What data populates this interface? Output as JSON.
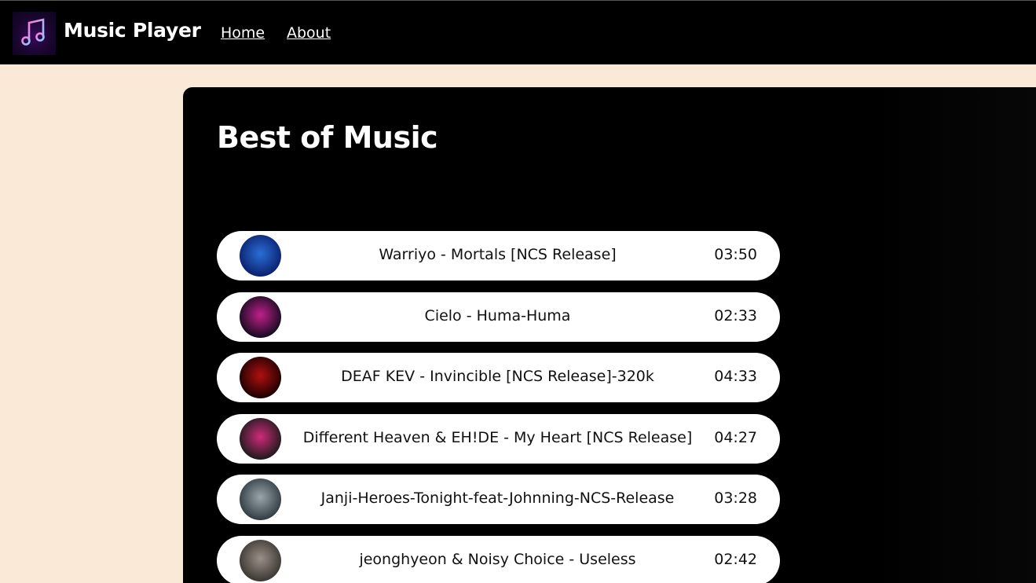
{
  "header": {
    "brand": "Music Player",
    "nav": [
      {
        "label": "Home"
      },
      {
        "label": "About"
      }
    ]
  },
  "main": {
    "title": "Best of Music",
    "songs": [
      {
        "name": "Warriyo - Mortals [NCS Release]",
        "duration": "03:50",
        "cover_colors": [
          "#0a1f6e",
          "#2a6fd6"
        ],
        "cover_text": ""
      },
      {
        "name": "Cielo - Huma-Huma",
        "duration": "02:33",
        "cover_colors": [
          "#120a1e",
          "#c0208a"
        ],
        "cover_text": ""
      },
      {
        "name": "DEAF KEV - Invincible [NCS Release]-320k",
        "duration": "04:33",
        "cover_colors": [
          "#1a0000",
          "#b01010"
        ],
        "cover_text": ""
      },
      {
        "name": "Different Heaven & EH!DE - My Heart [NCS Release]",
        "duration": "04:27",
        "cover_colors": [
          "#1a1a1a",
          "#d02a7a"
        ],
        "cover_text": ""
      },
      {
        "name": "Janji-Heroes-Tonight-feat-Johnning-NCS-Release",
        "duration": "03:28",
        "cover_colors": [
          "#2e3a40",
          "#9aa6ac"
        ],
        "cover_text": ""
      },
      {
        "name": "jeonghyeon & Noisy Choice - Useless",
        "duration": "02:42",
        "cover_colors": [
          "#3a3530",
          "#9a9088"
        ],
        "cover_text": ""
      }
    ]
  }
}
